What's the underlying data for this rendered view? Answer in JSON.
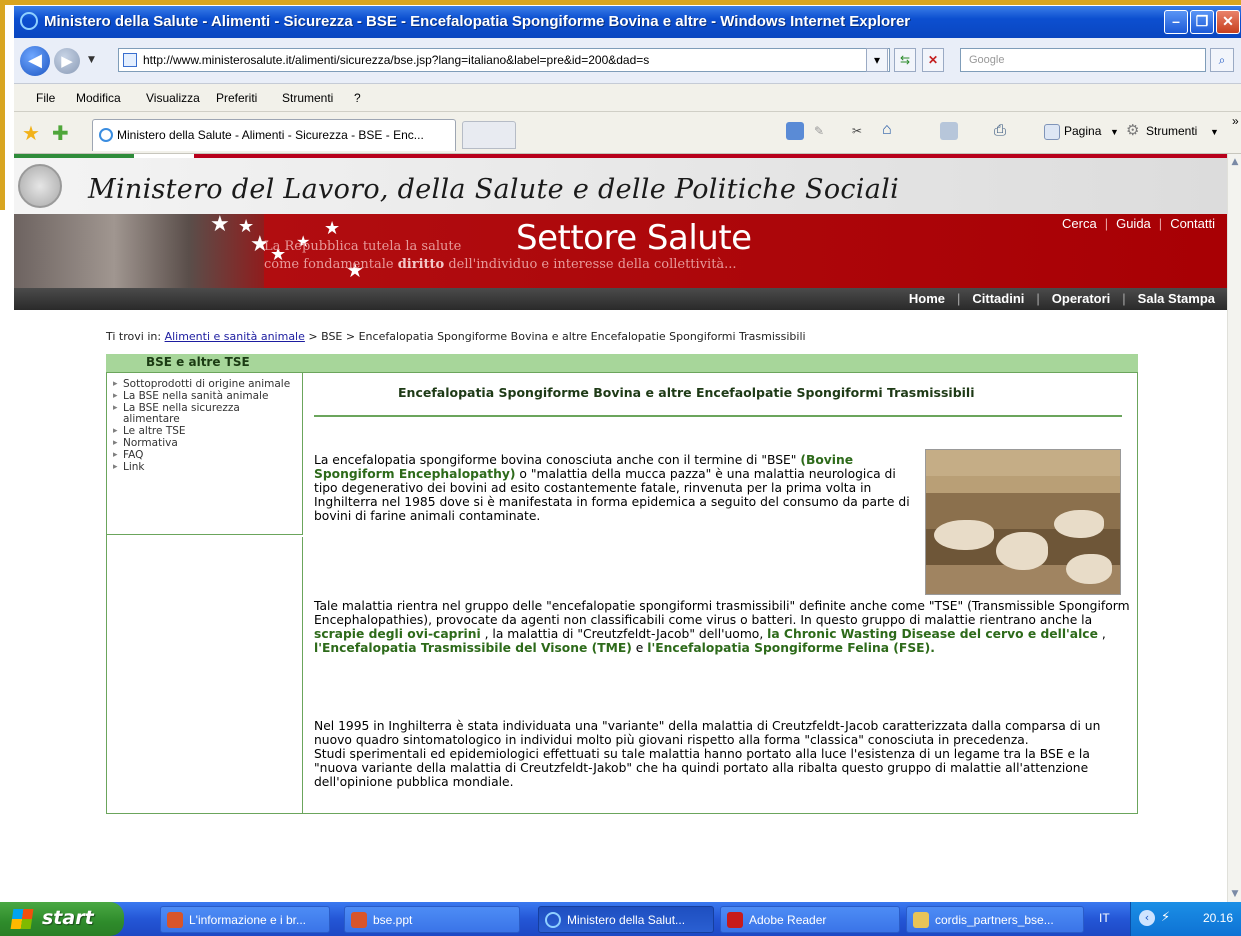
{
  "browser": {
    "window_title": "Ministero della Salute - Alimenti - Sicurezza - BSE - Encefalopatia Spongiforme Bovina e altre  - Windows Internet Explorer",
    "url": "http://www.ministerosalute.it/alimenti/sicurezza/bse.jsp?lang=italiano&label=pre&id=200&dad=s",
    "search_placeholder": "Google",
    "menu": [
      "File",
      "Modifica",
      "Visualizza",
      "Preferiti",
      "Strumenti",
      "?"
    ],
    "tab_label": "Ministero della Salute - Alimenti - Sicurezza - BSE - Enc...",
    "cmd_page": "Pagina",
    "cmd_tools": "Strumenti"
  },
  "site": {
    "ministry_title": "Ministero del Lavoro, della Salute e delle Politiche Sociali",
    "sector_title": "Settore Salute",
    "motto_line1": "La Repubblica tutela la salute",
    "motto_line2_a": "come fondamentale ",
    "motto_line2_b": "diritto",
    "motto_line2_c": " dell'individuo e interesse della collettività...",
    "util_links": [
      "Cerca",
      "Guida",
      "Contatti"
    ],
    "nav_links": [
      "Home",
      "Cittadini",
      "Operatori",
      "Sala Stampa"
    ]
  },
  "breadcrumb": {
    "prefix": "Ti trovi in: ",
    "link": "Alimenti e sanità animale",
    "rest": " > BSE > Encefalopatia Spongiforme Bovina e altre Encefalopatie Spongiformi Trasmissibili"
  },
  "sidebar": {
    "heading": "BSE e altre TSE",
    "items": [
      "Sottoprodotti di origine animale",
      "La BSE nella sanità animale",
      "La BSE nella sicurezza alimentare",
      "Le altre TSE",
      "Normativa",
      "FAQ",
      "Link"
    ]
  },
  "article": {
    "title": "Encefalopatia Spongiforme Bovina e altre Encefaolpatie Spongiformi Trasmissibili",
    "p1_a": "La encefalopatia spongiforme bovina conosciuta anche con il termine di \"BSE\" ",
    "p1_b": "(Bovine Spongiform Encephalopathy)",
    "p1_c": " o \"malattia della mucca pazza\" è una malattia neurologica di tipo degenerativo dei bovini ad esito costantemente fatale, rinvenuta per la prima volta in Inghilterra nel 1985 dove si è manifestata in forma epidemica a seguito del consumo da parte di bovini di farine animali contaminate.",
    "p2_a": "Tale malattia rientra nel gruppo delle \"encefalopatie spongiformi trasmissibili\" definite anche come \"TSE\" (Transmissible Spongiform Encephalopathies), provocate da agenti non classificabili come virus o batteri. In questo gruppo di malattie rientrano anche la ",
    "p2_b": "scrapie degli ovi-caprini",
    "p2_c": " , la malattia di \"Creutzfeldt-Jacob\" dell'uomo, ",
    "p2_d": "la Chronic Wasting Disease del cervo e dell'alce",
    "p2_e": " , ",
    "p2_f": "l'Encefalopatia Trasmissibile del Visone (TME)",
    "p2_g": " e ",
    "p2_h": "l'Encefalopatia Spongiforme Felina (FSE).",
    "p3": "Nel 1995 in Inghilterra è stata individuata una \"variante\" della malattia di Creutzfeldt-Jacob caratterizzata dalla comparsa di un nuovo quadro sintomatologico in individui molto più giovani rispetto alla forma \"classica\" conosciuta in precedenza.",
    "p4": "Studi sperimentali ed epidemiologici effettuati su tale malattia hanno portato alla luce l'esistenza di un legame tra la BSE e la \"nuova variante della malattia di Creutzfeldt-Jakob\" che ha quindi portato alla ribalta questo gruppo di malattie all'attenzione dell'opinione pubblica mondiale."
  },
  "taskbar": {
    "start": "start",
    "tasks": [
      "L'informazione e i br...",
      "bse.ppt",
      "Ministero della Salut...",
      "Adobe Reader",
      "cordis_partners_bse..."
    ],
    "lang": "IT",
    "clock": "20.16"
  }
}
